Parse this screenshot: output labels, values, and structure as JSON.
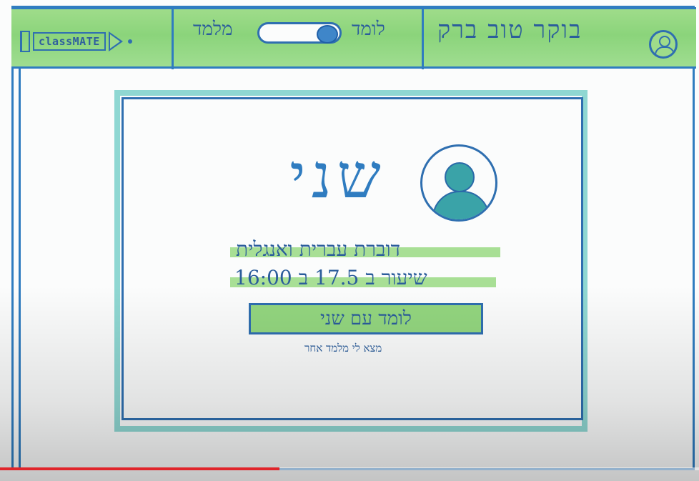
{
  "header": {
    "logo_text": "classMATE",
    "role_left": "מלמד",
    "role_right": "לומד",
    "greeting": "בוקר טוב ברק"
  },
  "card": {
    "tutor_name": "שני",
    "languages": "דוברת עברית ואנגלית",
    "lesson_time": "שיעור ב 17.5 ב 16:00",
    "cta_label": "לומד עם שני",
    "alt_link": "מצא לי מלמד אחר"
  },
  "video": {
    "progress": 0.4
  },
  "colors": {
    "marker_green": "#9fdc8a",
    "marker_blue": "#2f7cc0",
    "marker_teal": "#8fd7d2",
    "progress_red": "#e0242a"
  },
  "icons": {
    "logo_menu": "sidebar-bar-icon",
    "logo_play": "play-icon",
    "user": "user-avatar-icon"
  }
}
